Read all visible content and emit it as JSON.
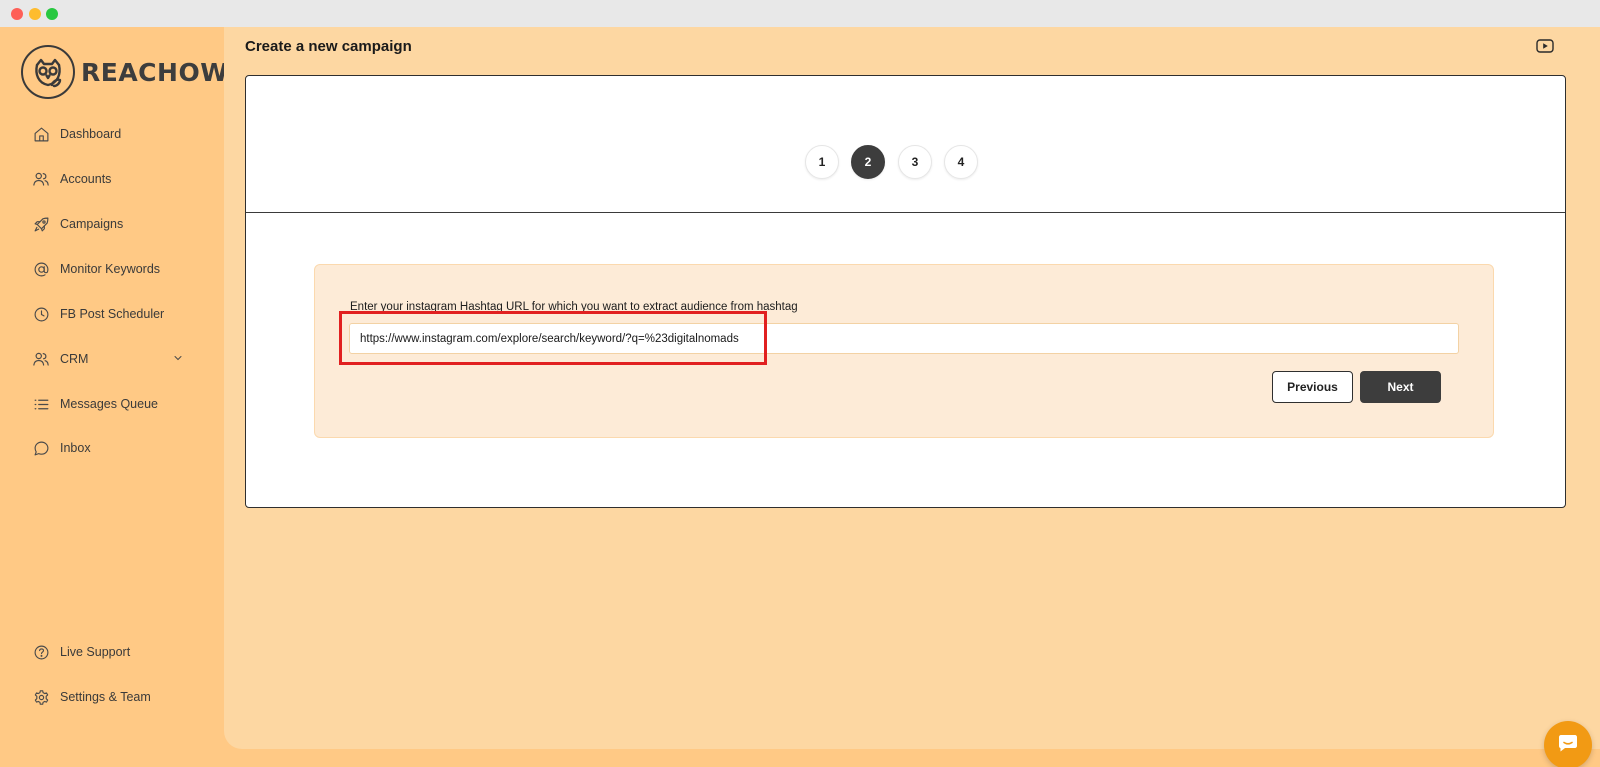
{
  "window": {
    "colors": {
      "close": "#fe5f57",
      "minimize": "#febc2e",
      "zoom": "#28c840"
    }
  },
  "brand": {
    "name": "REACHOWL",
    "logo_icon": "owl-icon"
  },
  "sidebar": {
    "items": [
      {
        "label": "Dashboard",
        "icon": "home-icon"
      },
      {
        "label": "Accounts",
        "icon": "users-icon"
      },
      {
        "label": "Campaigns",
        "icon": "rocket-icon"
      },
      {
        "label": "Monitor Keywords",
        "icon": "at-sign-icon"
      },
      {
        "label": "FB Post Scheduler",
        "icon": "clock-icon"
      },
      {
        "label": "CRM",
        "icon": "users-icon",
        "has_submenu": true
      },
      {
        "label": "Messages Queue",
        "icon": "list-icon"
      },
      {
        "label": "Inbox",
        "icon": "chat-bubble-icon"
      }
    ],
    "bottom_items": [
      {
        "label": "Live Support",
        "icon": "help-circle-icon"
      },
      {
        "label": "Settings & Team",
        "icon": "gear-icon"
      }
    ]
  },
  "header": {
    "title": "Create a new campaign",
    "video_icon": "video-tutorial-icon"
  },
  "stepper": {
    "steps": [
      "1",
      "2",
      "3",
      "4"
    ],
    "active_step": "2"
  },
  "form": {
    "label": "Enter your instagram Hashtag URL for which you want to extract audience from hashtag",
    "url_value": "https://www.instagram.com/explore/search/keyword/?q=%23digitalnomads",
    "previous_label": "Previous",
    "next_label": "Next"
  },
  "chat_widget": {
    "icon": "chat-icon"
  },
  "colors": {
    "sidebar_bg": "#ffc985",
    "main_bg": "#fdd7a2",
    "form_bg": "#fdebd7",
    "dark_button": "#3d3d3d",
    "highlight": "#e12020",
    "chat_fab": "#f29a14"
  }
}
